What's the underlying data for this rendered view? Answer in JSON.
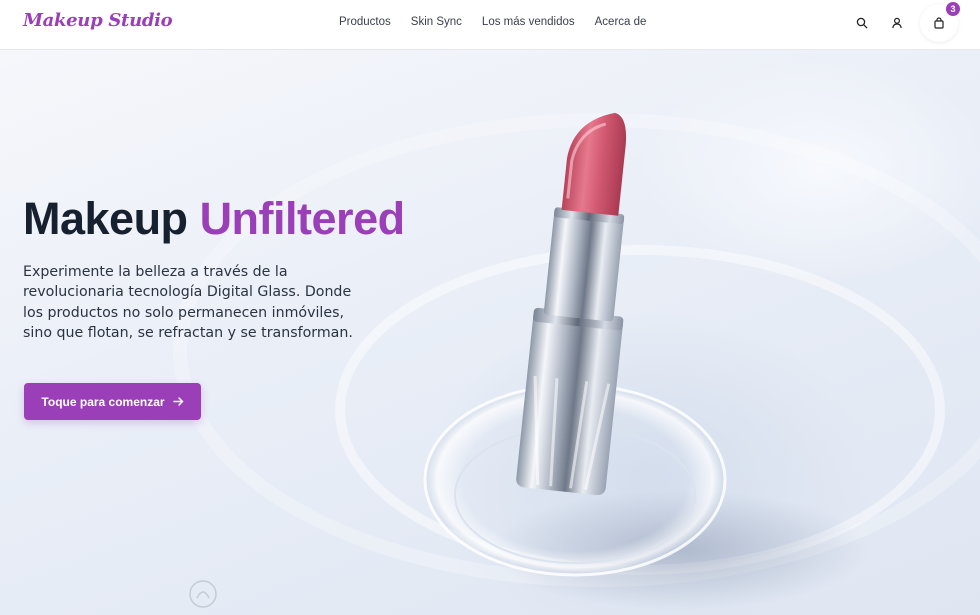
{
  "brand": {
    "logo_text": "Makeup Studio",
    "accent_color": "#9b3fb8"
  },
  "nav": {
    "items": [
      {
        "label": "Productos"
      },
      {
        "label": "Skin Sync"
      },
      {
        "label": "Los más vendidos"
      },
      {
        "label": "Acerca de"
      }
    ]
  },
  "header_actions": {
    "search_icon": "search-icon",
    "account_icon": "user-icon",
    "cart_icon": "shopping-bag-icon",
    "cart_count": "3"
  },
  "hero": {
    "headline_main": "Makeup",
    "headline_accent": "Unfiltered",
    "subtext": "Experimente la belleza a través de la revolucionaria tecnología Digital Glass. Donde los productos no solo permanecen inmóviles, sino que flotan, se refractan y se transforman.",
    "cta_label": "Toque para comenzar",
    "cta_icon": "arrow-right-icon",
    "image": "lipstick-in-glass-dish"
  }
}
